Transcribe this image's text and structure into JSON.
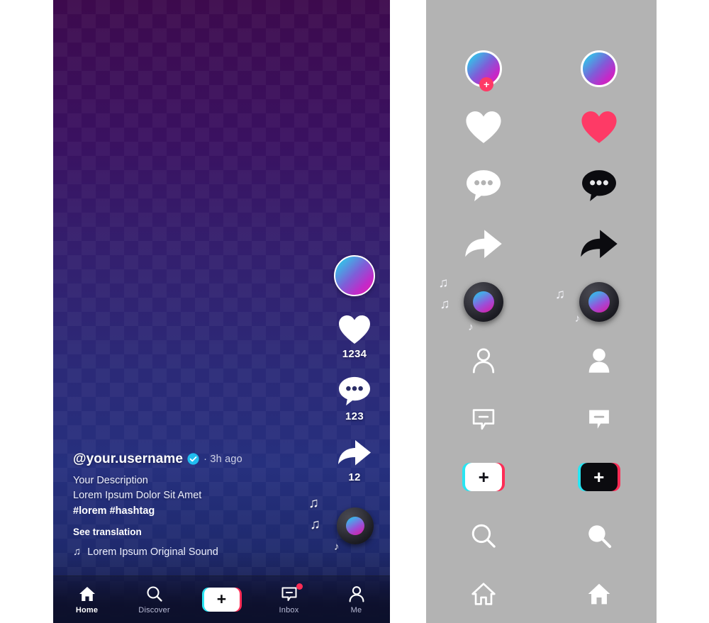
{
  "phone": {
    "post": {
      "username": "@your.username",
      "verified_icon": "verified-badge-icon",
      "time_ago": "· 3h ago",
      "description_line1": "Your Description",
      "description_line2": "Lorem Ipsum Dolor Sit Amet",
      "hashtags": "#lorem #hashtag",
      "see_translation": "See translation",
      "sound_note_icon": "music-note-icon",
      "sound_name": "Lorem Ipsum Original Sound"
    },
    "rail": {
      "avatar_name": "profile-avatar",
      "like_icon": "heart-icon",
      "like_count": "1234",
      "comment_icon": "comment-bubble-icon",
      "comment_count": "123",
      "share_icon": "share-arrow-icon",
      "share_count": "12",
      "disc_name": "music-disc-icon",
      "notes": [
        "♫",
        "♫",
        "♪"
      ]
    },
    "nav": {
      "items": [
        {
          "label": "Home",
          "icon": "home-icon",
          "active": true
        },
        {
          "label": "Discover",
          "icon": "search-icon",
          "active": false
        },
        {
          "label": "",
          "icon": "plus-create-icon",
          "active": false
        },
        {
          "label": "Inbox",
          "icon": "inbox-bubble-icon",
          "active": false,
          "badge": true
        },
        {
          "label": "Me",
          "icon": "person-icon",
          "active": false
        }
      ],
      "create_plus_sign": "+"
    },
    "colors": {
      "gradient_top": "#3d0a4d",
      "gradient_mid": "#2b2a78",
      "gradient_bottom": "#11153a",
      "accent_pink": "#fe2c55",
      "accent_cyan": "#28e5f2",
      "verified_blue": "#20bdf0"
    }
  },
  "icon_sheet": {
    "background": "#b3b3b3",
    "rows": [
      {
        "name": "avatar-with-plus",
        "left": "avatar-outline-with-add-badge",
        "right": "avatar-plain",
        "badge_sign": "+"
      },
      {
        "name": "heart",
        "left": "heart-white-icon",
        "right": "heart-pink-icon",
        "right_color": "#fe3a66"
      },
      {
        "name": "comment",
        "left": "comment-bubble-white-icon",
        "right": "comment-bubble-black-icon"
      },
      {
        "name": "share",
        "left": "share-arrow-white-icon",
        "right": "share-arrow-black-icon"
      },
      {
        "name": "music-disc",
        "left": "music-disc-icon",
        "right": "music-disc-icon"
      },
      {
        "name": "person",
        "left": "person-outline-icon",
        "right": "person-filled-icon"
      },
      {
        "name": "inbox",
        "left": "inbox-bubble-outline-icon",
        "right": "inbox-bubble-filled-icon"
      },
      {
        "name": "create",
        "left": "plus-create-light-icon",
        "right": "plus-create-dark-icon",
        "sign": "+"
      },
      {
        "name": "search",
        "left": "search-outline-icon",
        "right": "search-filled-icon"
      },
      {
        "name": "home",
        "left": "home-outline-icon",
        "right": "home-filled-icon"
      }
    ]
  }
}
